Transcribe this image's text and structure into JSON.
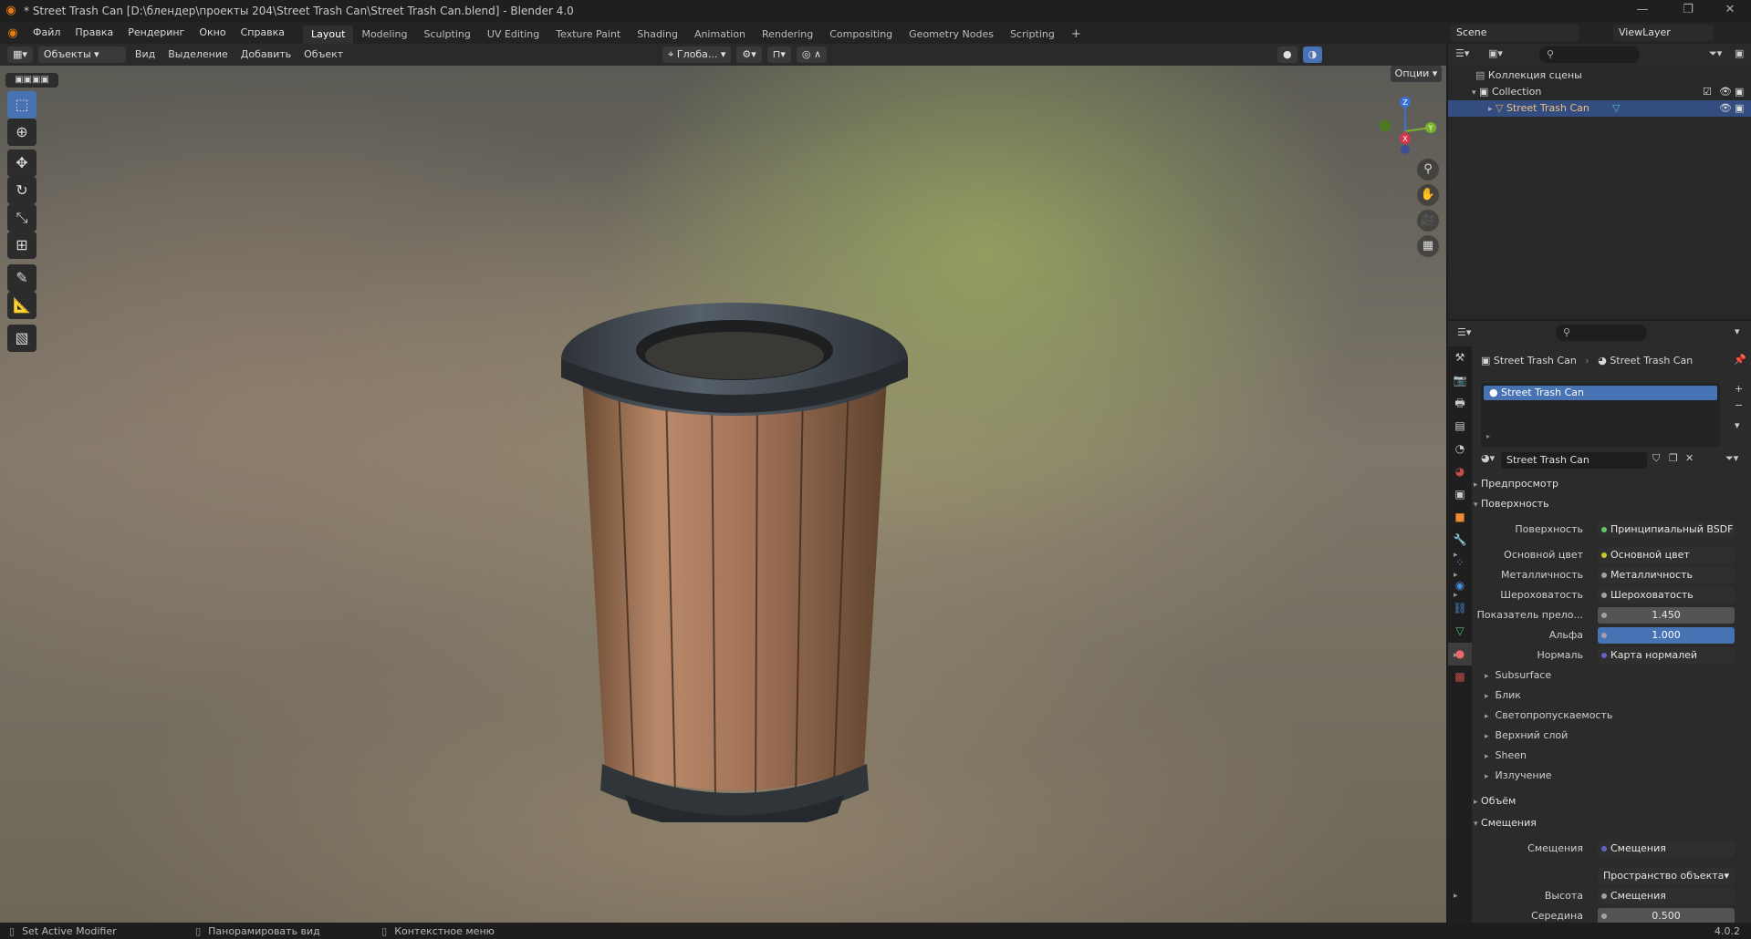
{
  "app": {
    "title": "* Street Trash Can [D:\\блендер\\проекты 204\\Street Trash Can\\Street Trash Can.blend] - Blender 4.0",
    "version": "4.0.2"
  },
  "menus": [
    "Файл",
    "Правка",
    "Рендеринг",
    "Окно",
    "Справка"
  ],
  "workspaces": [
    "Layout",
    "Modeling",
    "Sculpting",
    "UV Editing",
    "Texture Paint",
    "Shading",
    "Animation",
    "Rendering",
    "Compositing",
    "Geometry Nodes",
    "Scripting"
  ],
  "active_workspace": "Layout",
  "scene": {
    "label": "Scene",
    "view_layer": "ViewLayer"
  },
  "viewport_header": {
    "mode": "Объекты",
    "menus": [
      "Вид",
      "Выделение",
      "Добавить",
      "Объект"
    ],
    "orientation": "Глоба...",
    "options": "Опции"
  },
  "gizmo": {
    "z": "Z",
    "y": "Y",
    "x": "X"
  },
  "outliner": {
    "root": "Коллекция сцены",
    "collection": "Collection",
    "object": "Street Trash Can"
  },
  "properties": {
    "breadcrumb_object": "Street Trash Can",
    "breadcrumb_material": "Street Trash Can",
    "slot_name": "Street Trash Can",
    "material_name": "Street Trash Can",
    "panels": {
      "preview": "Предпросмотр",
      "surface": "Поверхность",
      "volume": "Объём",
      "displacement": "Смещения"
    },
    "surface_rows": [
      {
        "label": "Поверхность",
        "value": "Принципиальный BSDF",
        "kind": "link",
        "dot": "#63c763"
      },
      {
        "label": "Основной цвет",
        "value": "Основной цвет",
        "kind": "link",
        "dot": "#c7c729"
      },
      {
        "label": "Металличность",
        "value": "Металличность",
        "kind": "link",
        "dot": "#a1a1a1"
      },
      {
        "label": "Шероховатость",
        "value": "Шероховатость",
        "kind": "link",
        "dot": "#a1a1a1"
      },
      {
        "label": "Показатель прело...",
        "value": "1.450",
        "kind": "num",
        "dot": "#a1a1a1"
      },
      {
        "label": "Альфа",
        "value": "1.000",
        "kind": "blue",
        "dot": "#a1a1a1"
      },
      {
        "label": "Нормаль",
        "value": "Карта нормалей",
        "kind": "link",
        "dot": "#6363c7"
      }
    ],
    "sub_panels": [
      "Subsurface",
      "Блик",
      "Светопропускаемость",
      "Верхний слой",
      "Sheen",
      "Излучение"
    ],
    "displacement_rows": [
      {
        "label": "Смещения",
        "value": "Смещения",
        "kind": "link",
        "dot": "#6363c7"
      },
      {
        "label": "",
        "value": "Пространство объекта",
        "kind": "drop",
        "dot": ""
      },
      {
        "label": "Высота",
        "value": "Смещения",
        "kind": "link",
        "dot": "#a1a1a1"
      },
      {
        "label": "Середина",
        "value": "0.500",
        "kind": "num",
        "dot": "#a1a1a1"
      }
    ]
  },
  "status_bar": [
    "Set Active Modifier",
    "Панорамировать вид",
    "Контекстное меню"
  ],
  "colors": {
    "accent": "#4772b3",
    "active_tab_material": "#c44c4c"
  }
}
